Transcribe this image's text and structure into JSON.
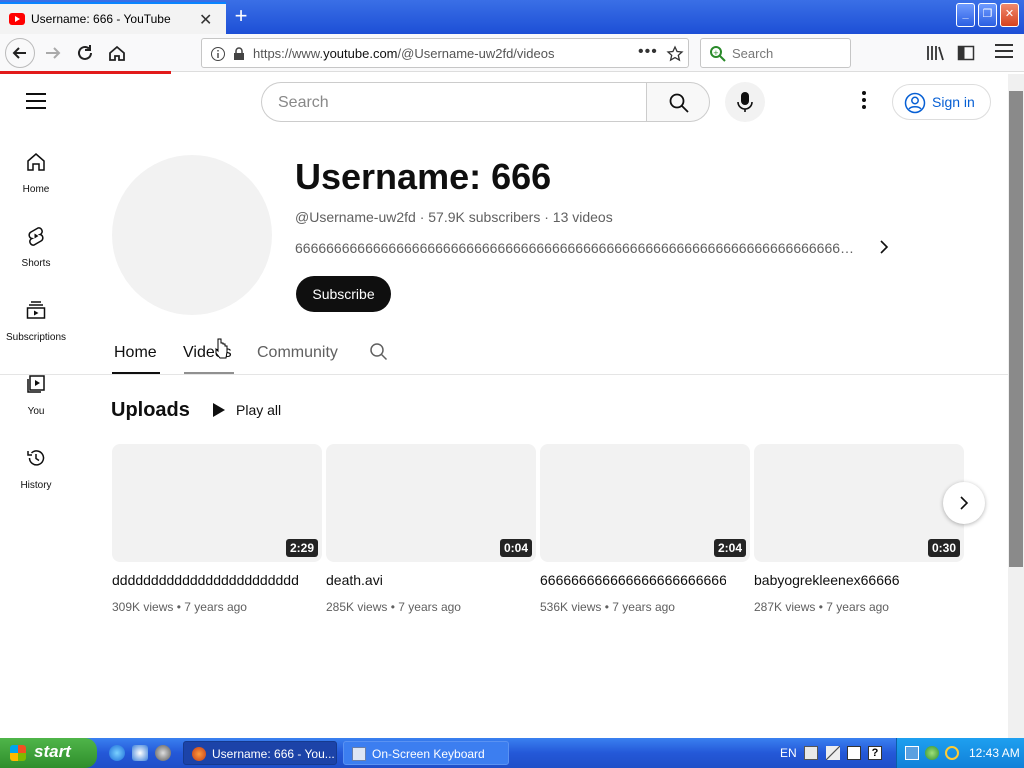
{
  "browser": {
    "tab_title": "Username: 666 - YouTube",
    "url_prefix": "https://www.",
    "url_host": "youtube.com",
    "url_path": "/@Username-uw2fd/videos",
    "search_placeholder": "Search",
    "accent_color": "#0a84ff"
  },
  "youtube": {
    "search_placeholder": "Search",
    "sign_in_label": "Sign in",
    "guide": [
      {
        "label": "Home",
        "icon": "home-icon"
      },
      {
        "label": "Shorts",
        "icon": "shorts-icon"
      },
      {
        "label": "Subscriptions",
        "icon": "subscriptions-icon"
      },
      {
        "label": "You",
        "icon": "you-icon"
      },
      {
        "label": "History",
        "icon": "history-icon"
      }
    ],
    "channel": {
      "name": "Username: 666",
      "handle": "@Username-uw2fd",
      "subscribers": "57.9K subscribers",
      "video_count": "13 videos",
      "meta_separator": "·",
      "description": "66666666666666666666666666666666666666666666666666666666666666666666666666666...",
      "subscribe_label": "Subscribe"
    },
    "tabs": [
      "Home",
      "Videos",
      "Community"
    ],
    "uploads_title": "Uploads",
    "play_all_label": "Play all",
    "videos": [
      {
        "title": "ddddddddddddddddddddddddd",
        "duration": "2:29",
        "views": "309K views",
        "age": "7 years ago"
      },
      {
        "title": "death.avi",
        "duration": "0:04",
        "views": "285K views",
        "age": "7 years ago"
      },
      {
        "title": "66666666666666666666666666",
        "duration": "2:04",
        "views": "536K views",
        "age": "7 years ago"
      },
      {
        "title": "babyogrekleenex66666",
        "duration": "0:30",
        "views": "287K views",
        "age": "7 years ago"
      }
    ],
    "meta_dot": "•"
  },
  "taskbar": {
    "start_label": "start",
    "items": [
      {
        "label": "Username: 666 - You..."
      },
      {
        "label": "On-Screen Keyboard"
      }
    ],
    "language": "EN",
    "time": "12:43 AM"
  }
}
